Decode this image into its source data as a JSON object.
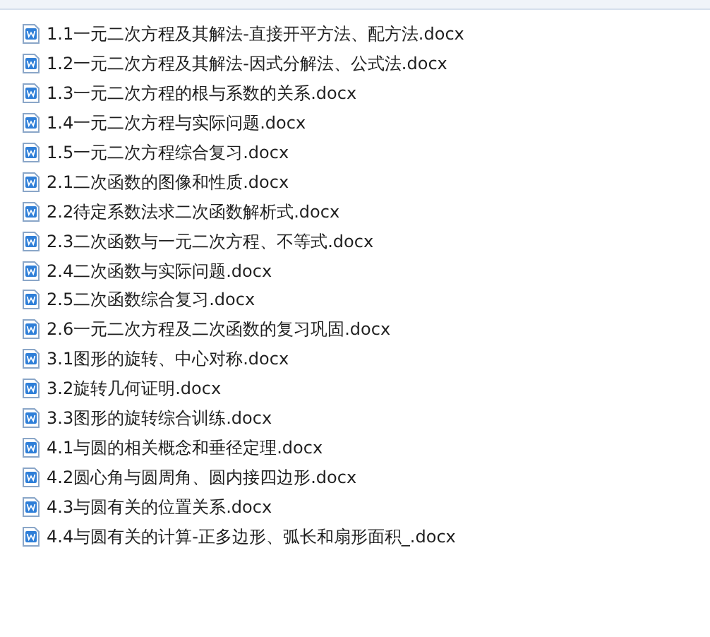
{
  "files": [
    {
      "name": "1.1一元二次方程及其解法-直接开平方法、配方法.docx"
    },
    {
      "name": "1.2一元二次方程及其解法-因式分解法、公式法.docx"
    },
    {
      "name": "1.3一元二次方程的根与系数的关系.docx"
    },
    {
      "name": "1.4一元二次方程与实际问题.docx"
    },
    {
      "name": "1.5一元二次方程综合复习.docx"
    },
    {
      "name": "2.1二次函数的图像和性质.docx"
    },
    {
      "name": "2.2待定系数法求二次函数解析式.docx"
    },
    {
      "name": "2.3二次函数与一元二次方程、不等式.docx"
    },
    {
      "name": "2.4二次函数与实际问题.docx"
    },
    {
      "name": "2.5二次函数综合复习.docx"
    },
    {
      "name": "2.6一元二次方程及二次函数的复习巩固.docx"
    },
    {
      "name": "3.1图形的旋转、中心对称.docx"
    },
    {
      "name": "3.2旋转几何证明.docx"
    },
    {
      "name": "3.3图形的旋转综合训练.docx"
    },
    {
      "name": "4.1与圆的相关概念和垂径定理.docx"
    },
    {
      "name": "4.2圆心角与圆周角、圆内接四边形.docx"
    },
    {
      "name": "4.3与圆有关的位置关系.docx"
    },
    {
      "name": "4.4与圆有关的计算-正多边形、弧长和扇形面积_.docx"
    }
  ]
}
